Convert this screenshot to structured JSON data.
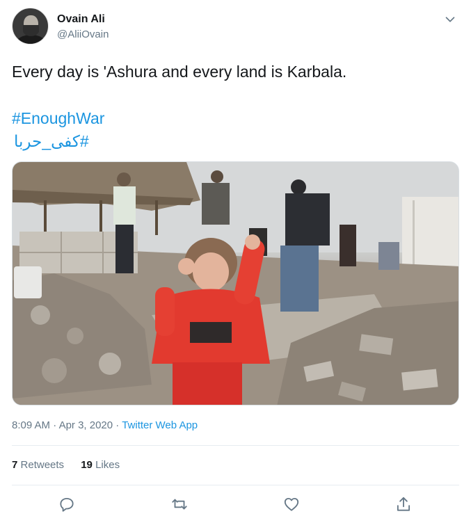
{
  "tweet": {
    "author": {
      "display_name": "Ovain Ali",
      "handle": "@AliiOvain"
    },
    "text": "Every day is 'Ashura and every land is Karbala.",
    "hashtags": [
      "#EnoughWar",
      "#كفى_حربا"
    ],
    "time": "8:09 AM",
    "date": "Apr 3, 2020",
    "source": "Twitter Web App",
    "retweets": "7",
    "retweets_label": "Retweets",
    "likes": "19",
    "likes_label": "Likes"
  },
  "icons": {
    "caret": "chevron-down-icon",
    "reply": "reply-icon",
    "retweet": "retweet-icon",
    "like": "heart-icon",
    "share": "share-icon"
  },
  "colors": {
    "link": "#1b95e0",
    "secondary_text": "#657786",
    "primary_text": "#14171a",
    "divider": "#e6ecf0"
  }
}
